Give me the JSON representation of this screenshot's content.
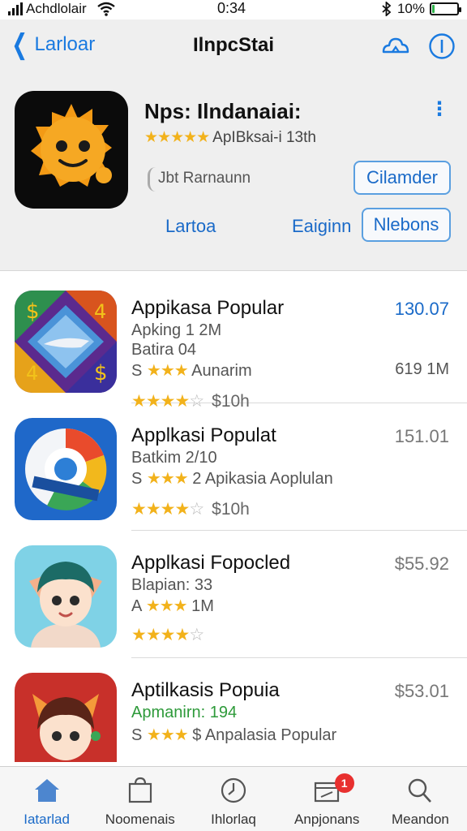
{
  "status_bar": {
    "carrier": "Achdlolair",
    "time": "0:34",
    "battery": "10%",
    "battery_level": 0.1
  },
  "nav": {
    "back_label": "Larloar",
    "title": "IlnpcStai"
  },
  "hero": {
    "title": "Nps: Ilndanaiai:",
    "rating_stars": 5,
    "rating_text": "ApIBksai-i 13th",
    "developer": "Jbt Rarnaunn",
    "btn_top_right": "Cilamder",
    "link_left": "Lartoa",
    "link_right": "Eaiginn",
    "btn_bottom_right": "Nlebons"
  },
  "apps": [
    {
      "title": "Appikasa Popular",
      "price": "130.07",
      "price_color": "#1a6ac8",
      "line1": "Apking 1 2M",
      "line2": "Batira 04",
      "line3_prefix": "S",
      "line3_stars": 3,
      "line3_text": "Aunarim",
      "line3_side": "619 1M",
      "rating_stars": 4,
      "rating_text": "$10h"
    },
    {
      "title": "Applkasi Populat",
      "price": "151.01",
      "line1": "Batkim 2/10",
      "line2_prefix": "S",
      "line2_stars": 3,
      "line2_text": "2 Apikasia Aoplulan",
      "rating_stars": 4,
      "rating_text": "$10h"
    },
    {
      "title": "Applkasi Fopocled",
      "price": "$55.92",
      "line1": "Blapian: 33",
      "line2_prefix": "A",
      "line2_stars": 3,
      "line2_text": "1M",
      "rating_stars": 4
    },
    {
      "title": "Aptilkasis Popuia",
      "price": "$53.01",
      "line1": "Apmanirn: 194",
      "line1_color": "#2e9a3a",
      "line2_prefix": "S",
      "line2_stars": 3,
      "line2_text": "$ Anpalasia Popular"
    }
  ],
  "tabs": [
    {
      "label": "Iatarlad",
      "icon": "home-icon",
      "active": true
    },
    {
      "label": "Noomenais",
      "icon": "bag-icon"
    },
    {
      "label": "Ihlorlaq",
      "icon": "clock-icon"
    },
    {
      "label": "Anpjonans",
      "icon": "updates-icon",
      "badge": "1"
    },
    {
      "label": "Meandon",
      "icon": "search-icon"
    }
  ]
}
